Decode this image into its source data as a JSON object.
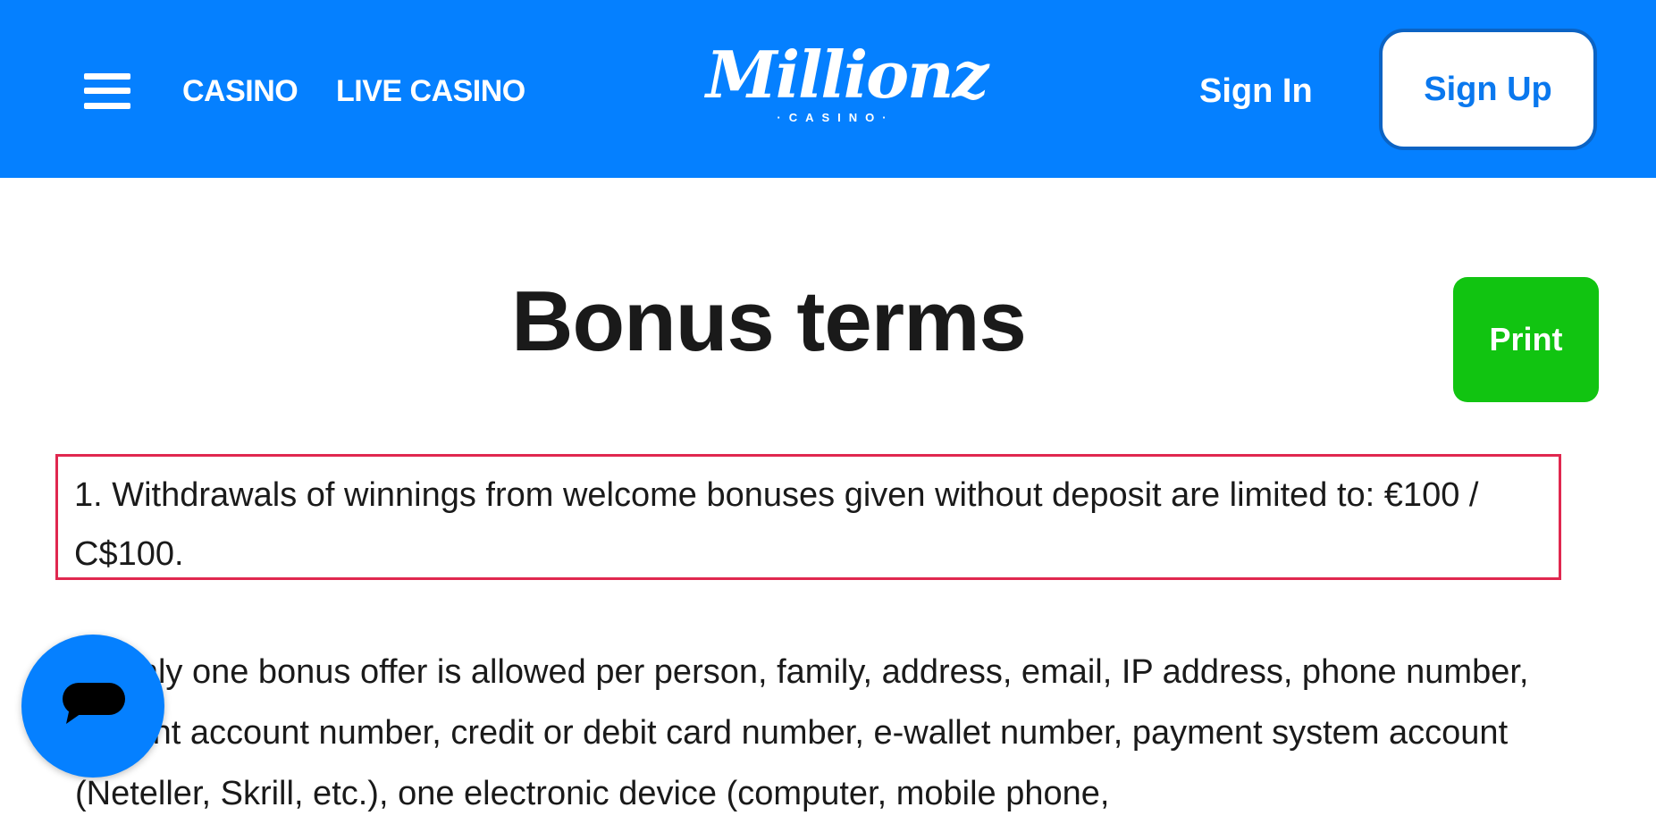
{
  "header": {
    "nav": {
      "casino": "CASINO",
      "live_casino": "LIVE CASINO"
    },
    "logo": {
      "main": "Millionz",
      "sub": "·CASINO·"
    },
    "sign_in": "Sign In",
    "sign_up": "Sign Up"
  },
  "main": {
    "title": "Bonus terms",
    "print_label": "Print",
    "terms": [
      "1. Withdrawals of winnings from welcome bonuses given without deposit are limited to: €100 / C$100.",
      "2. Only one bonus offer is allowed per person, family, address, email, IP address, phone number, current account number, credit or debit card number, e-wallet number, payment system account (Neteller, Skrill, etc.), one electronic device (computer, mobile phone,"
    ]
  },
  "colors": {
    "header_bg": "#0580ff",
    "print_bg": "#11c411",
    "highlight_border": "#e0284f"
  },
  "icons": {
    "menu": "hamburger-icon",
    "chat": "chat-bubble-icon"
  }
}
